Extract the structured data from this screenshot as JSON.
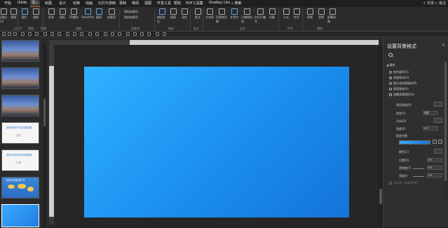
{
  "menu": {
    "tabs": [
      "开始",
      "iSlide",
      "插入",
      "绘图",
      "设计",
      "切换",
      "动画",
      "幻灯片放映",
      "录制",
      "审阅",
      "视图",
      "开发工具",
      "帮助",
      "PDF工具集",
      "OneKey Lite"
    ],
    "active_index": 2,
    "search_label": "搜索",
    "share_label": "共享",
    "comment_label": "批注"
  },
  "ribbon": {
    "buttons": [
      "新建幻灯片",
      "表格",
      "图片",
      "图像",
      "形状",
      "图标",
      "3D模型",
      "SmartArt",
      "图表",
      "加载项",
      "缩放定位",
      "链接",
      "动作",
      "批注",
      "文本框",
      "页眉和页脚",
      "艺术字",
      "日期和时间",
      "幻灯片编号",
      "对象",
      "公式",
      "符号",
      "视频",
      "音频",
      "屏幕录制"
    ],
    "groups": [
      "幻灯片",
      "表格",
      "图像",
      "插图",
      "加载项",
      "链接",
      "批注",
      "文本",
      "符号",
      "媒体"
    ],
    "addin_items": [
      "获取加载项",
      "我的加载项"
    ]
  },
  "thumbnails": [
    {
      "kind": "city"
    },
    {
      "kind": "city"
    },
    {
      "kind": "city"
    },
    {
      "kind": "white",
      "title": "西安·南京市文化旅游局",
      "sub": "文化"
    },
    {
      "kind": "white",
      "title": "西安·南京市文化旅游局",
      "sub": "门类"
    },
    {
      "kind": "map",
      "title": "世界文化旅游产业"
    },
    {
      "kind": "selected"
    }
  ],
  "panel": {
    "title": "设置背景格式",
    "section_fill": "填充",
    "fill_options": [
      {
        "label": "纯色填充(S)",
        "checked": false
      },
      {
        "label": "渐变填充(G)",
        "checked": true
      },
      {
        "label": "图片或纹理填充(P)",
        "checked": false
      },
      {
        "label": "图案填充(A)",
        "checked": false
      }
    ],
    "hide_bg_label": "隐藏背景图形(H)",
    "preset_label": "预设渐变(R)",
    "type_label": "类型(Y)",
    "type_value": "线性",
    "direction_label": "方向(D)",
    "angle_label": "角度(E)",
    "angle_value": "45°",
    "stops_label": "渐变光圈",
    "color_label": "颜色(C)",
    "position_label": "位置(O)",
    "position_value": "0%",
    "transparency_label": "透明度(T)",
    "transparency_value": "0%",
    "brightness_label": "亮度(I)",
    "brightness_value": "0%",
    "rotate_label": "与形状一起旋转(W)"
  },
  "colors": {
    "accent": "#c75b3b",
    "slide_gradient_start": "#2fb2ff",
    "slide_gradient_end": "#1474d8"
  }
}
